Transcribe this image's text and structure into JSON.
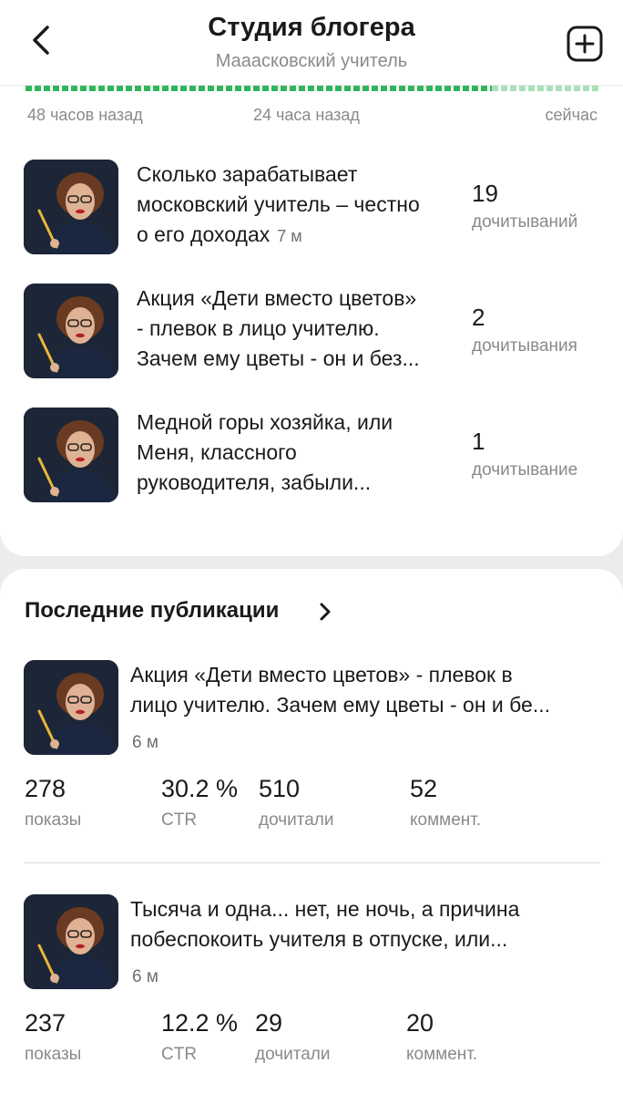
{
  "header": {
    "title": "Студия блогера",
    "subtitle": "Мааасковский учитель"
  },
  "timeline": {
    "labels": [
      "48 часов назад",
      "24 часа назад",
      "сейчас"
    ]
  },
  "top_articles": [
    {
      "title_lines": [
        "Сколько зарабатывает",
        "московский учитель – честно",
        "о его доходах"
      ],
      "age": "7 м",
      "reads": "19",
      "reads_label": "дочитываний"
    },
    {
      "title_lines": [
        "Акция «Дети вместо цветов»",
        "- плевок в лицо учителю.",
        "Зачем ему цветы - он и без..."
      ],
      "reads": "2",
      "reads_label": "дочитывания"
    },
    {
      "title_lines": [
        "Медной горы хозяйка, или",
        "Меня, классного",
        "руководителя, забыли..."
      ],
      "reads": "1",
      "reads_label": "дочитывание"
    }
  ],
  "recent": {
    "title": "Последние публикации",
    "items": [
      {
        "title_lines": [
          "Акция «Дети вместо цветов» - плевок в",
          "лицо учителю. Зачем ему цветы - он и бе..."
        ],
        "age": "6 м",
        "metrics": [
          {
            "value": "278",
            "label": "показы"
          },
          {
            "value": "30.2 %",
            "label": "CTR"
          },
          {
            "value": "510",
            "label": "дочитали"
          },
          {
            "value": "52",
            "label": "коммент."
          }
        ]
      },
      {
        "title_lines": [
          "Тысяча и одна... нет, не ночь, а причина",
          "побеспокоить учителя в отпуске, или..."
        ],
        "age": "6 м",
        "metrics": [
          {
            "value": "237",
            "label": "показы"
          },
          {
            "value": "12.2 %",
            "label": "CTR"
          },
          {
            "value": "29",
            "label": "дочитали"
          },
          {
            "value": "20",
            "label": "коммент."
          }
        ]
      }
    ]
  },
  "icons": {
    "back": "chevron-left-icon",
    "add": "plus-square-icon",
    "section": "chevron-right-icon"
  },
  "colors": {
    "accent_green": "#2fb65a",
    "text_primary": "#1a1a1a",
    "text_secondary": "#8a8a8a",
    "background": "#ececef"
  }
}
